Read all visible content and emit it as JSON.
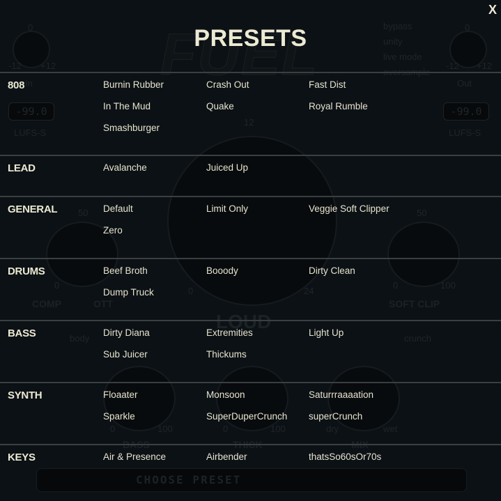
{
  "background": {
    "logo": "FUEL",
    "in_knob": {
      "top": "0",
      "min": "-12",
      "max": "+12",
      "label": "In"
    },
    "out_knob": {
      "top": "0",
      "min": "-12",
      "max": "+12",
      "label": "Out"
    },
    "lufs_left": {
      "value": "-99.0",
      "label": "LUFS-S"
    },
    "lufs_right": {
      "value": "-99.0",
      "label": "LUFS-S"
    },
    "options": [
      "bypass",
      "unity",
      "live mode",
      "oversample"
    ],
    "loud": {
      "top": "12",
      "min": "0",
      "max": "24",
      "label": "LOUD"
    },
    "comp": {
      "top": "50",
      "min": "0",
      "label": "COMP",
      "toggle": "OTT",
      "sub": "body"
    },
    "soft_clip": {
      "top": "50",
      "min": "0",
      "max": "100",
      "label": "SOFT CLIP",
      "sub": "crunch"
    },
    "bass": {
      "min": "0",
      "max": "100",
      "label": "BASS"
    },
    "thick": {
      "min": "0",
      "max": "100",
      "label": "THICK"
    },
    "mix": {
      "min": "dry",
      "max": "wet",
      "label": "MIX"
    },
    "preset_bar": {
      "label": "CHOOSE PRESET"
    }
  },
  "presets": {
    "title": "PRESETS",
    "close_label": "X",
    "categories": [
      {
        "name": "808",
        "items": [
          "Burnin Rubber",
          "Crash Out",
          "Fast Dist",
          "In The Mud",
          "Quake",
          "Royal Rumble",
          "Smashburger"
        ]
      },
      {
        "name": "LEAD",
        "items": [
          "Avalanche",
          "Juiced Up"
        ]
      },
      {
        "name": "GENERAL",
        "items": [
          "Default",
          "Limit Only",
          "Veggie Soft Clipper",
          "Zero"
        ]
      },
      {
        "name": "DRUMS",
        "items": [
          "Beef Broth",
          "Booody",
          "Dirty Clean",
          "Dump Truck"
        ]
      },
      {
        "name": "BASS",
        "items": [
          "Dirty Diana",
          "Extremities",
          "Light Up",
          "Sub Juicer",
          "Thickums"
        ]
      },
      {
        "name": "SYNTH",
        "items": [
          "Floaater",
          "Monsoon",
          "Saturrraaaation",
          "Sparkle",
          "SuperDuperCrunch",
          "superCrunch"
        ]
      },
      {
        "name": "KEYS",
        "items": [
          "Air & Presence",
          "Airbender",
          "thatsSo60sOr70s"
        ]
      }
    ]
  },
  "colors": {
    "text": "#ecead3",
    "background": "#0c1115",
    "separator": "#3a3f42"
  }
}
